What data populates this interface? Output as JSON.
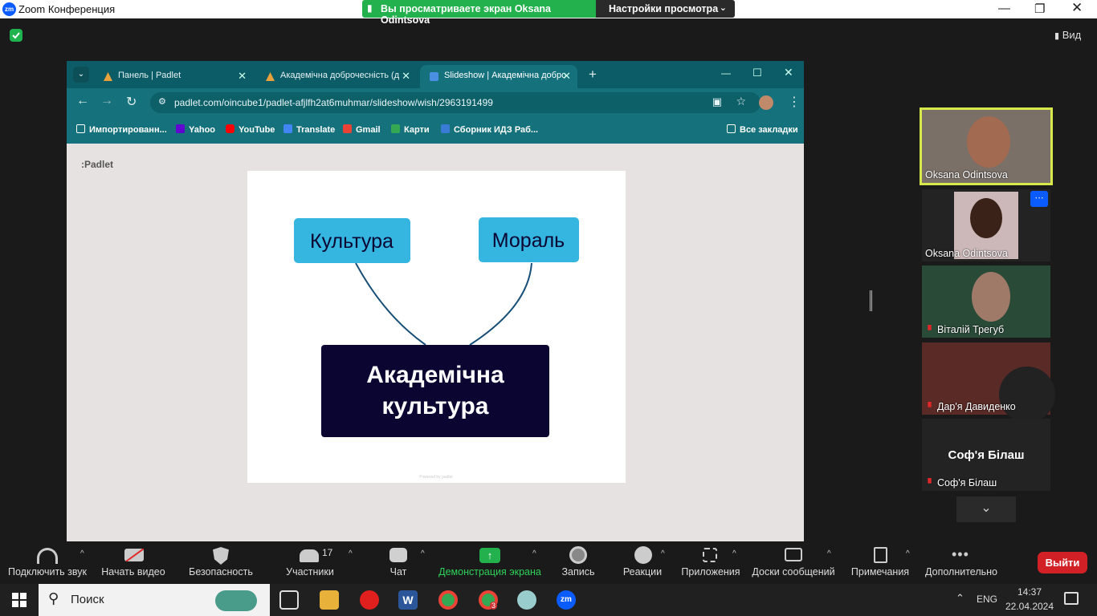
{
  "window": {
    "logo": "zm",
    "title": "Zoom Конференция"
  },
  "share_banner": {
    "text": "Вы просматриваете экран Oksana Odintsova",
    "options": "Настройки просмотра"
  },
  "view_label": "Вид",
  "browser": {
    "tabs": [
      {
        "label": "Панель | Padlet"
      },
      {
        "label": "Академічна доброчесність (д"
      },
      {
        "label": "Slideshow | Академічна добро"
      }
    ],
    "url": "padlet.com/oincube1/padlet-afjlfh2at6muhmar/slideshow/wish/2963191499",
    "bookmarks": [
      "Импортированн...",
      "Yahoo",
      "YouTube",
      "Translate",
      "Gmail",
      "Карти",
      "Сборник ИДЗ Раб..."
    ],
    "all_bookmarks": "Все закладки"
  },
  "padlet": {
    "logo": ":Padlet",
    "box1": "Культура",
    "box2": "Мораль",
    "main_line1": "Академічна",
    "main_line2": "культура",
    "footer": "Powered by padlet"
  },
  "participants": [
    {
      "name": "Oksana Odintsova"
    },
    {
      "name": "Oksana Odintsova"
    },
    {
      "name": "Віталій Трегуб"
    },
    {
      "name": "Дар'я Давиденко"
    },
    {
      "name": "Соф'я Білаш",
      "big": "Соф'я Білаш"
    }
  ],
  "toolbar": {
    "audio": "Подключить звук",
    "video": "Начать видео",
    "security": "Безопасность",
    "participants": "Участники",
    "participants_count": "17",
    "chat": "Чат",
    "share": "Демонстрация экрана",
    "record": "Запись",
    "reactions": "Реакции",
    "apps": "Приложения",
    "boards": "Доски сообщений",
    "notes": "Примечания",
    "more": "Дополнительно",
    "leave": "Выйти"
  },
  "taskbar": {
    "search": "Поиск",
    "lang": "ENG",
    "time": "14:37",
    "date": "22.04.2024",
    "chrome_badge": "3"
  },
  "colors": {
    "share_green": "#23b14d",
    "browser_teal": "#15717b",
    "box_blue": "#35b6e0",
    "main_box": "#0b0531",
    "leave_red": "#d12127",
    "active_speaker": "#d6e84a"
  }
}
